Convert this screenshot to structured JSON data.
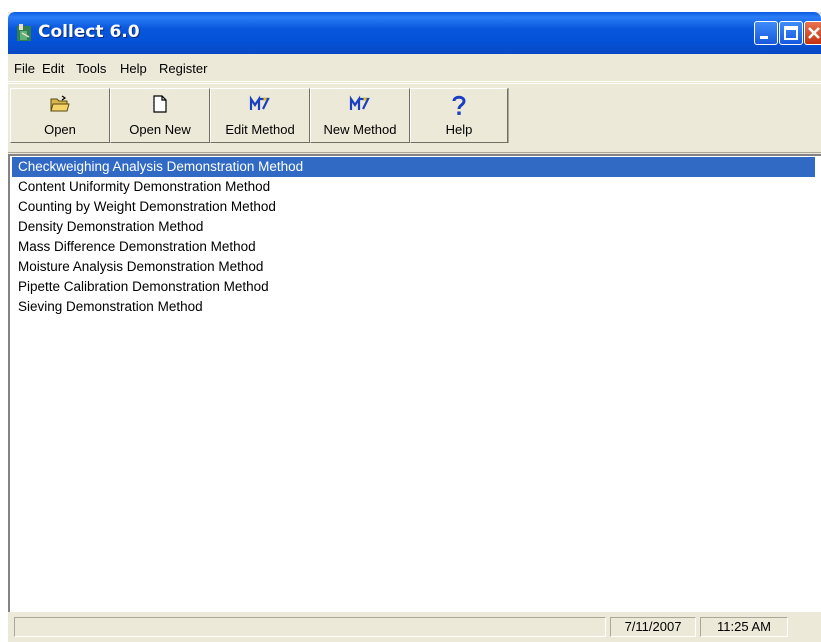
{
  "window": {
    "title": "Collect 6.0"
  },
  "menu": {
    "items": [
      "File",
      "Edit",
      "Tools",
      "Help",
      "Register"
    ]
  },
  "toolbar": {
    "buttons": [
      {
        "label": "Open",
        "icon": "open-folder-icon"
      },
      {
        "label": "Open New",
        "icon": "new-document-icon"
      },
      {
        "label": "Edit Method",
        "icon": "method-icon"
      },
      {
        "label": "New Method",
        "icon": "method-icon"
      },
      {
        "label": "Help",
        "icon": "question-mark-icon"
      }
    ]
  },
  "methods": {
    "items": [
      "Checkweighing Analysis Demonstration Method",
      "Content Uniformity Demonstration Method",
      "Counting by Weight Demonstration Method",
      "Density Demonstration Method",
      "Mass Difference Demonstration Method",
      "Moisture Analysis Demonstration Method",
      "Pipette Calibration Demonstration Method",
      "Sieving Demonstration Method"
    ],
    "selected_index": 0
  },
  "status": {
    "date": "7/11/2007",
    "time": "11:25 AM"
  },
  "colors": {
    "titlebar": "#0352d8",
    "selection": "#316ac5",
    "chrome": "#ece9d8",
    "close": "#c3320f"
  }
}
